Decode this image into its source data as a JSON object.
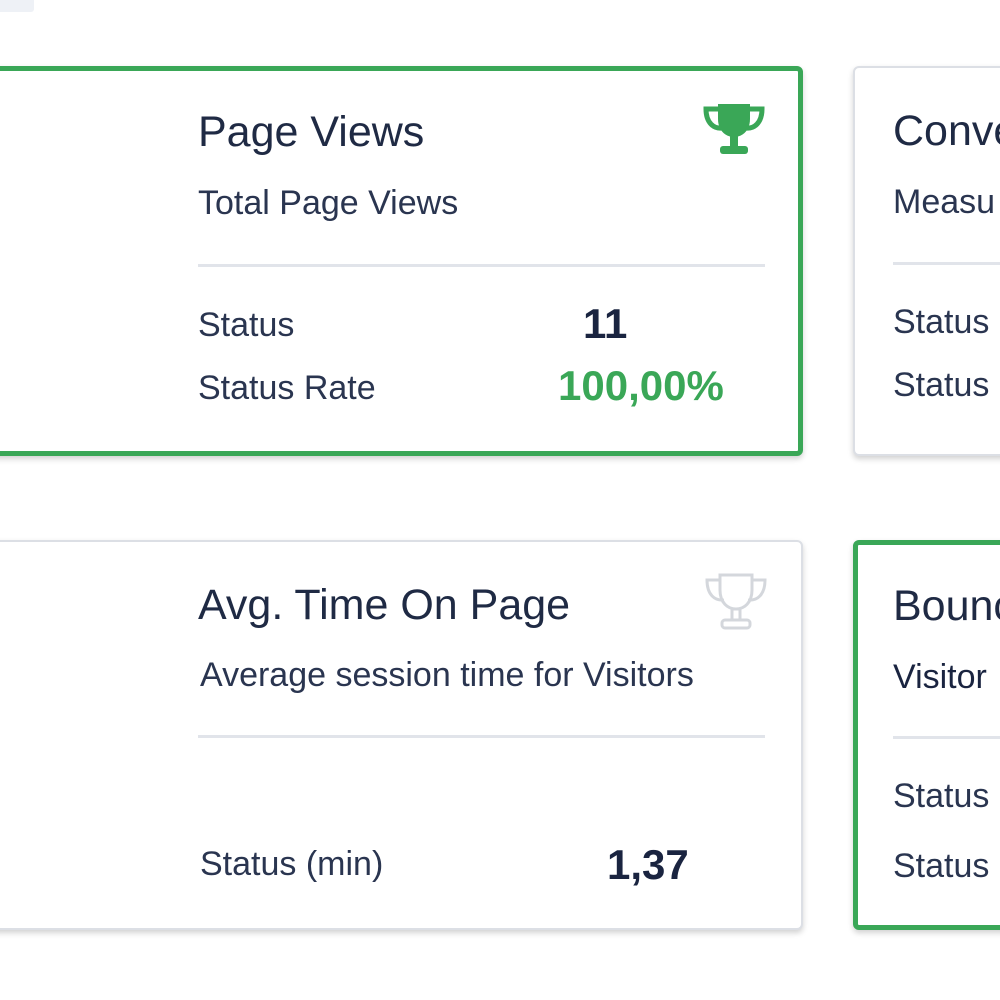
{
  "colors": {
    "winner_accent": "#3aa757",
    "card_border": "#dcdfe5",
    "text_primary": "#1f2a44",
    "trophy_inactive": "#d4d7dc"
  },
  "cards": {
    "page_views": {
      "title": "Page Views",
      "subtitle": "Total Page Views",
      "icon": "trophy-icon",
      "status_label": "Status",
      "status_value": "11",
      "rate_label": "Status Rate",
      "rate_value": "100,00%"
    },
    "conversions": {
      "title": "Conve",
      "subtitle": "Measu",
      "status_label": "Status",
      "rate_label": "Status"
    },
    "avg_time": {
      "title": "Avg. Time On Page",
      "subtitle": "Average session time for Visitors",
      "icon": "trophy-outline-icon",
      "status_label": "Status (min)",
      "status_value": "1,37"
    },
    "bounce": {
      "title": "Bounc",
      "subtitle": "Visitor",
      "status_label": "Status",
      "rate_label": "Status"
    }
  }
}
